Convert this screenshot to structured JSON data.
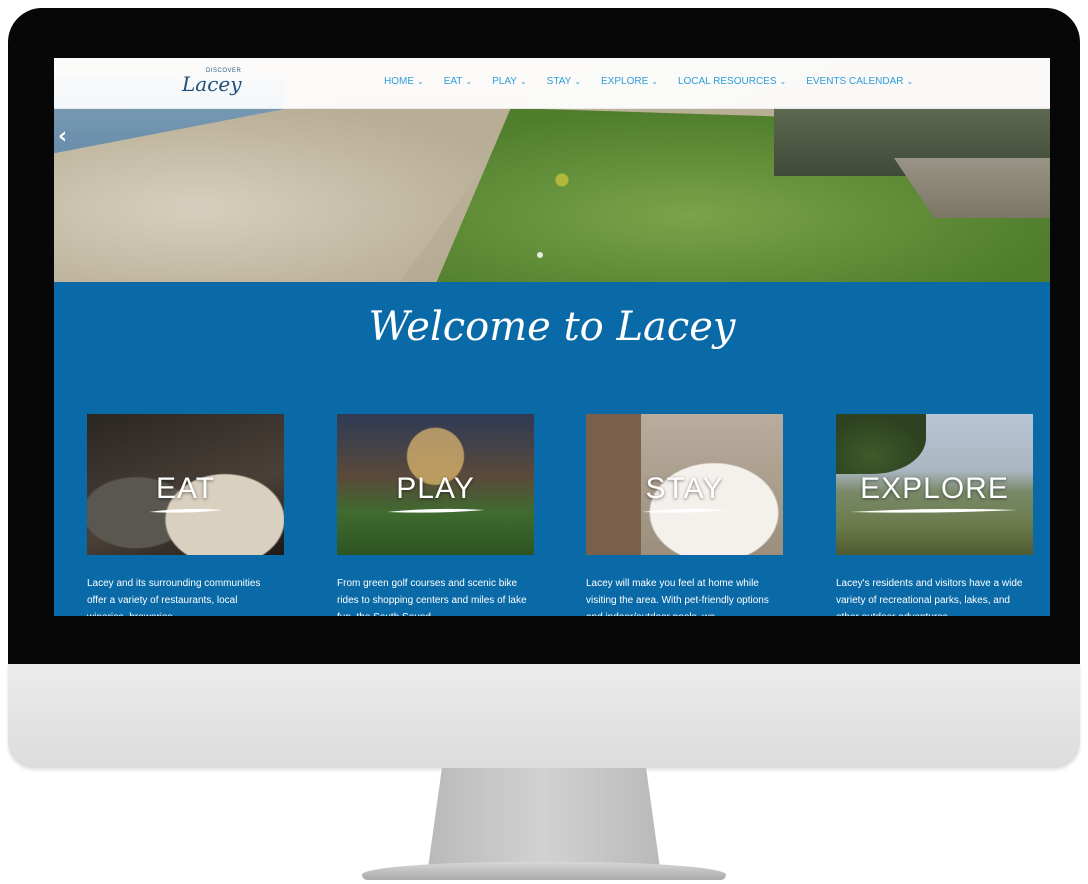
{
  "site": {
    "logo_small": "Discover",
    "logo_script": "Lacey"
  },
  "nav": {
    "items": [
      {
        "label": "HOME"
      },
      {
        "label": "EAT"
      },
      {
        "label": "PLAY"
      },
      {
        "label": "STAY"
      },
      {
        "label": "EXPLORE"
      },
      {
        "label": "LOCAL RESOURCES"
      },
      {
        "label": "EVENTS CALENDAR"
      }
    ],
    "caret": "⌄"
  },
  "hero": {
    "prev_arrow": "‹"
  },
  "welcome": {
    "title": "Welcome to Lacey"
  },
  "cards": [
    {
      "title": "EAT",
      "description": "Lacey and its surrounding communities offer a variety of restaurants, local wineries, breweries"
    },
    {
      "title": "PLAY",
      "description": "From green golf courses and scenic bike rides to shopping centers and miles of lake fun, the South Sound"
    },
    {
      "title": "STAY",
      "description": "Lacey will make you feel at home while visiting the area. With pet-friendly options and indoor/outdoor pools, we"
    },
    {
      "title": "EXPLORE",
      "description": "Lacey's residents and visitors have a wide variety of recreational parks, lakes, and other outdoor adventures"
    }
  ],
  "colors": {
    "brand_blue": "#0a6aa8",
    "nav_link": "#2f9ed9"
  }
}
